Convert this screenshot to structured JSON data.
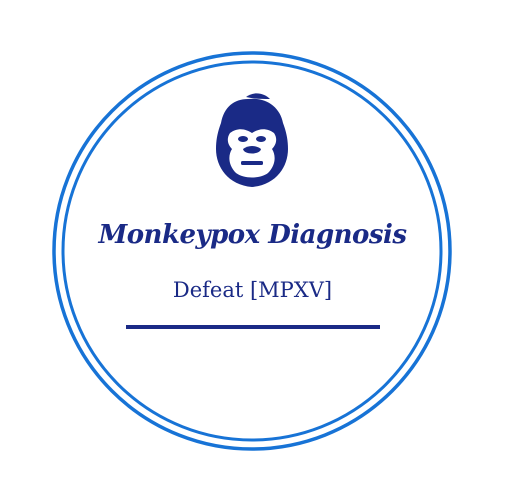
{
  "logo": {
    "icon": "gorilla-icon",
    "title": "Monkeypox Diagnosis",
    "subtitle": "Defeat [MPXV]"
  },
  "colors": {
    "ring": "#1773d6",
    "title": "#1a2a86",
    "icon": "#1a2a86",
    "subtitle": "#1a2a86",
    "rule": "#1a2a86",
    "background": "#ffffff"
  }
}
